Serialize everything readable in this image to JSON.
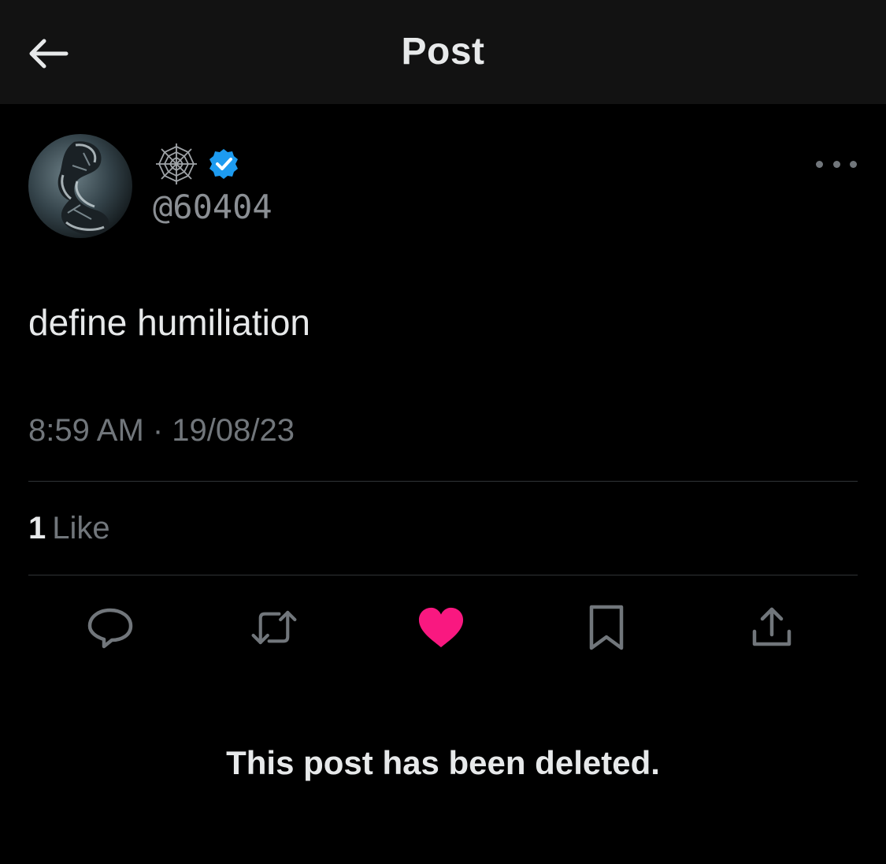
{
  "header": {
    "title": "Post",
    "back_icon": "arrow-left-icon"
  },
  "author": {
    "display_name_emoji": "spider-web-emoji",
    "verified": true,
    "handle": "@60404",
    "avatar": "spider-figure-avatar"
  },
  "post": {
    "text": "define humiliation",
    "timestamp": "8:59 AM · 19/08/23",
    "likes_count": "1",
    "likes_label": "Like",
    "liked": true
  },
  "actions": [
    {
      "name": "reply",
      "icon": "speech-bubble-icon"
    },
    {
      "name": "repost",
      "icon": "repost-arrows-icon"
    },
    {
      "name": "like",
      "icon": "heart-icon"
    },
    {
      "name": "bookmark",
      "icon": "bookmark-icon"
    },
    {
      "name": "share",
      "icon": "share-upload-icon"
    }
  ],
  "notice": "This post has been deleted.",
  "colors": {
    "background": "#000000",
    "header_bg": "#121212",
    "text": "#e7e9ea",
    "muted": "#71767b",
    "verified_blue": "#1d9bf0",
    "like_pink": "#f91880",
    "divider": "#2f3336"
  }
}
